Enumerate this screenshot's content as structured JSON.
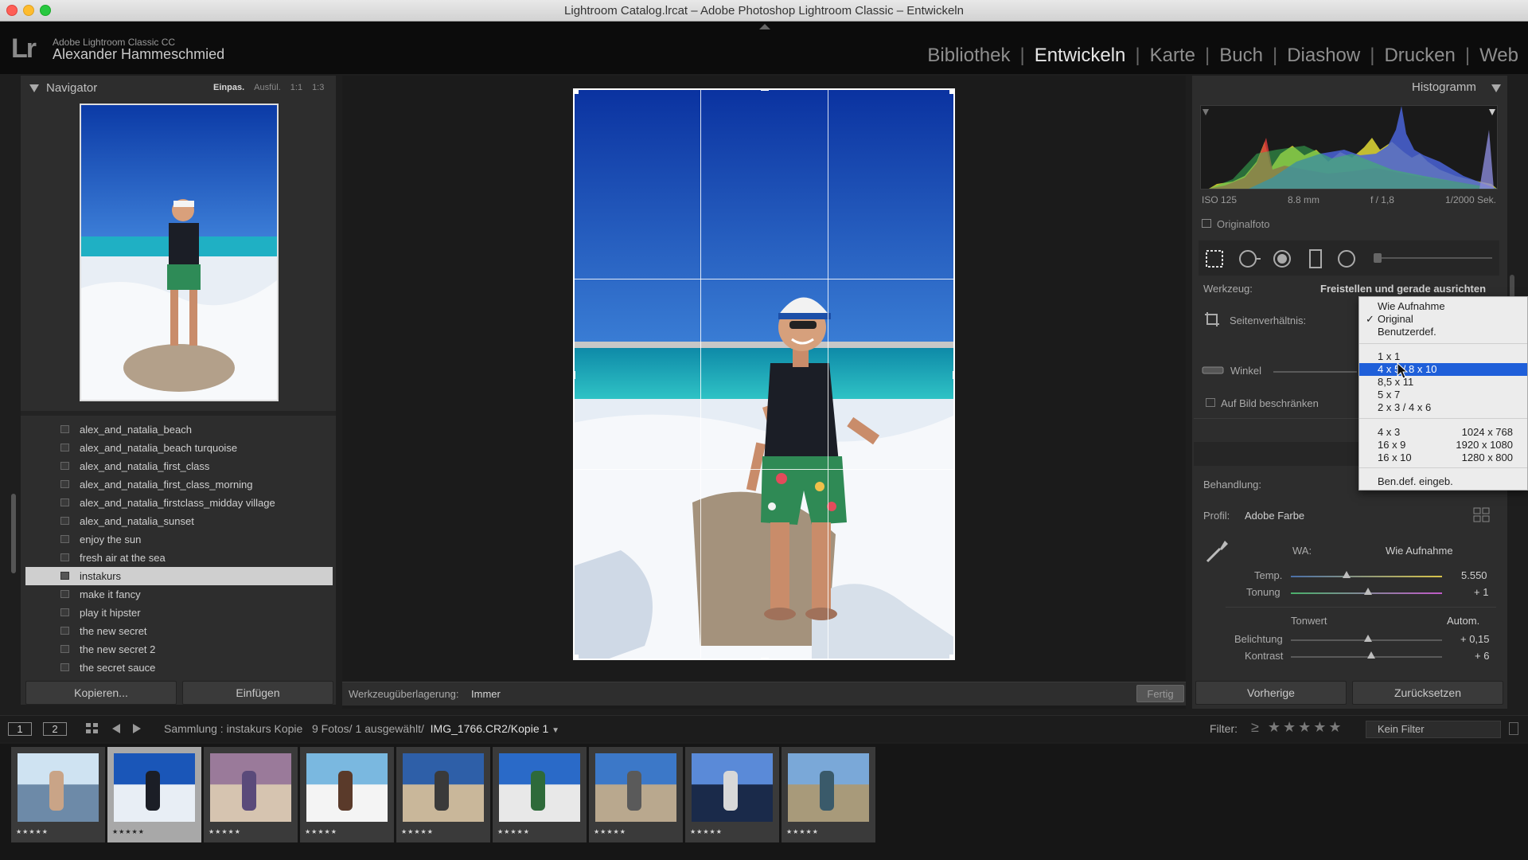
{
  "window": {
    "title": "Lightroom Catalog.lrcat – Adobe Photoshop Lightroom Classic – Entwickeln"
  },
  "identity": {
    "logo": "Lr",
    "app_name": "Adobe Lightroom Classic CC",
    "user_name": "Alexander Hammeschmied"
  },
  "modules": [
    {
      "label": "Bibliothek",
      "active": false
    },
    {
      "label": "Entwickeln",
      "active": true
    },
    {
      "label": "Karte",
      "active": false
    },
    {
      "label": "Buch",
      "active": false
    },
    {
      "label": "Diashow",
      "active": false
    },
    {
      "label": "Drucken",
      "active": false
    },
    {
      "label": "Web",
      "active": false
    }
  ],
  "navigator": {
    "title": "Navigator",
    "zoom": [
      "Einpas.",
      "Ausfül.",
      "1:1",
      "1:3"
    ]
  },
  "collections": [
    {
      "label": "alex_and_natalia_beach",
      "selected": false
    },
    {
      "label": "alex_and_natalia_beach turquoise",
      "selected": false
    },
    {
      "label": "alex_and_natalia_first_class",
      "selected": false
    },
    {
      "label": "alex_and_natalia_first_class_morning",
      "selected": false
    },
    {
      "label": "alex_and_natalia_firstclass_midday village",
      "selected": false
    },
    {
      "label": "alex_and_natalia_sunset",
      "selected": false
    },
    {
      "label": "enjoy the sun",
      "selected": false
    },
    {
      "label": "fresh air at the sea",
      "selected": false
    },
    {
      "label": "instakurs",
      "selected": true
    },
    {
      "label": "make it fancy",
      "selected": false
    },
    {
      "label": "play it hipster",
      "selected": false
    },
    {
      "label": "the new secret",
      "selected": false
    },
    {
      "label": "the new secret 2",
      "selected": false
    },
    {
      "label": "the secret sauce",
      "selected": false
    }
  ],
  "left_buttons": {
    "copy": "Kopieren...",
    "paste": "Einfügen"
  },
  "toolbar": {
    "overlay_label": "Werkzeugüberlagerung:",
    "overlay_value": "Immer",
    "done": "Fertig"
  },
  "histogram": {
    "title": "Histogramm",
    "iso": "ISO 125",
    "focal": "8.8 mm",
    "aperture": "f / 1,8",
    "shutter": "1/2000 Sek.",
    "original_photo": "Originalfoto"
  },
  "crop": {
    "tool_label": "Werkzeug:",
    "tool_value": "Freistellen und gerade ausrichten",
    "aspect_label": "Seitenverhältnis:",
    "angle_label": "Winkel",
    "constrain_label": "Auf Bild beschränken"
  },
  "aspect_dropdown": {
    "items": [
      {
        "label": "Wie Aufnahme",
        "checked": false,
        "highlighted": false
      },
      {
        "label": "Original",
        "checked": true,
        "highlighted": false
      },
      {
        "label": "Benutzerdef.",
        "checked": false,
        "highlighted": false
      },
      {
        "label": "1 x 1",
        "checked": false,
        "highlighted": false
      },
      {
        "label": "4 x 5 / 8 x 10",
        "checked": false,
        "highlighted": true
      },
      {
        "label": "8,5 x 11",
        "checked": false,
        "highlighted": false
      },
      {
        "label": "5 x 7",
        "checked": false,
        "highlighted": false
      },
      {
        "label": "2 x 3 / 4 x 6",
        "checked": false,
        "highlighted": false
      },
      {
        "label": "4 x 3",
        "res": "1024 x 768"
      },
      {
        "label": "16 x 9",
        "res": "1920 x 1080"
      },
      {
        "label": "16 x 10",
        "res": "1280 x 800"
      },
      {
        "label": "Ben.def. eingeb."
      }
    ]
  },
  "basic": {
    "treatment_label": "Behandlung:",
    "profile_label": "Profil:",
    "profile_value": "Adobe Farbe",
    "wb_label": "WA:",
    "wb_value": "Wie Aufnahme",
    "temp_label": "Temp.",
    "temp_value": "5.550",
    "temp_pos": 0.37,
    "tint_label": "Tonung",
    "tint_value": "+ 1",
    "tint_pos": 0.51,
    "tone_label": "Tonwert",
    "auto_label": "Autom.",
    "exposure_label": "Belichtung",
    "exposure_value": "+ 0,15",
    "exposure_pos": 0.51,
    "contrast_label": "Kontrast",
    "contrast_value": "+ 6",
    "contrast_pos": 0.53
  },
  "right_buttons": {
    "previous": "Vorherige",
    "reset": "Zurücksetzen"
  },
  "filmstrip_bar": {
    "page1": "1",
    "page2": "2",
    "source": "Sammlung : instakurs Kopie",
    "count": "9 Fotos/ 1 ausgewählt/",
    "file": "IMG_1766.CR2/Kopie 1",
    "filter_label": "Filter:",
    "stars": "≥ ★★★★★",
    "filter_value": "Kein Filter"
  },
  "filmstrip": [
    {
      "stars": "★★★★★",
      "selected": false,
      "theme": "woman"
    },
    {
      "stars": "★★★★★",
      "selected": true,
      "theme": "man"
    },
    {
      "stars": "★★★★★",
      "selected": false,
      "theme": "shells"
    },
    {
      "stars": "★★★★★",
      "selected": false,
      "theme": "plate"
    },
    {
      "stars": "★★★★★",
      "selected": false,
      "theme": "couple"
    },
    {
      "stars": "★★★★★",
      "selected": false,
      "theme": "lighthouse"
    },
    {
      "stars": "★★★★★",
      "selected": false,
      "theme": "beach"
    },
    {
      "stars": "★★★★★",
      "selected": false,
      "theme": "signs"
    },
    {
      "stars": "★★★★★",
      "selected": false,
      "theme": "shore"
    }
  ],
  "colors": {
    "accent": "#1f5fd9",
    "sky": "#1a56b8",
    "sea": "#1fb6c6"
  }
}
